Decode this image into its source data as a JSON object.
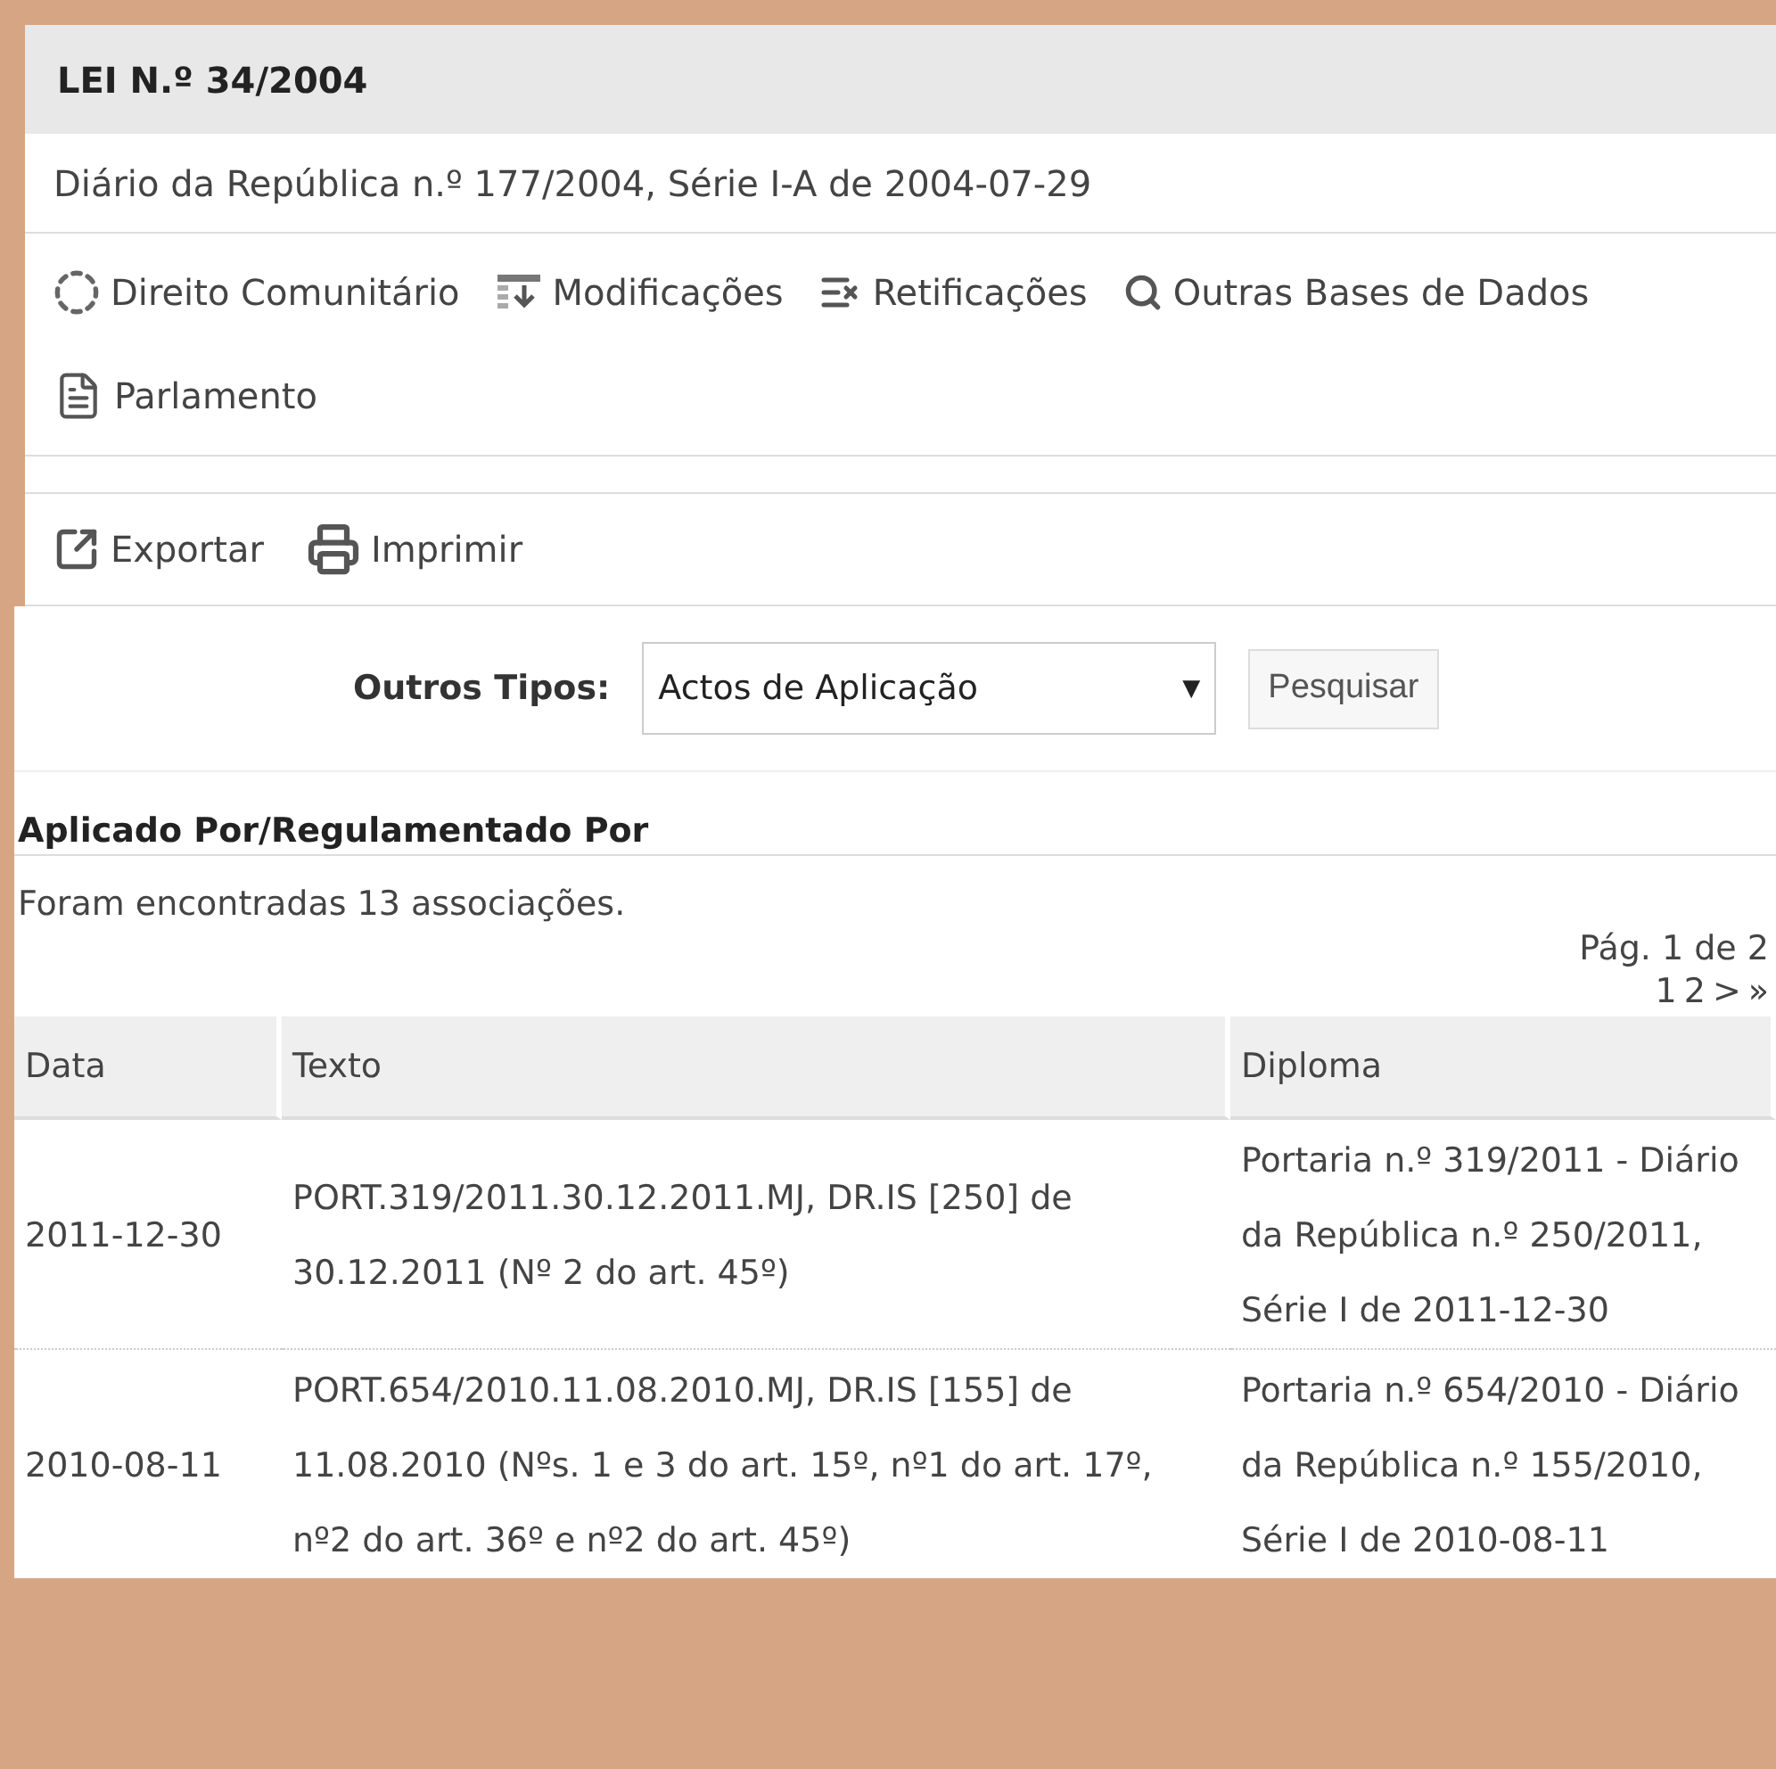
{
  "title": "LEI N.º 34/2004",
  "subtitle": "Diário da República n.º 177/2004, Série I-A de 2004-07-29",
  "links": [
    {
      "kind": "community",
      "label": "Direito Comunitário"
    },
    {
      "kind": "changes",
      "label": "Modificações"
    },
    {
      "kind": "corrections",
      "label": "Retificações"
    },
    {
      "kind": "search",
      "label": "Outras Bases de Dados"
    },
    {
      "kind": "parliament",
      "label": "Parlamento"
    }
  ],
  "actions": [
    {
      "kind": "export",
      "label": "Exportar"
    },
    {
      "kind": "print",
      "label": "Imprimir"
    }
  ],
  "filter": {
    "label": "Outros Tipos:",
    "value": "Actos de Aplicação",
    "caret": "▼",
    "button": "Pesquisar"
  },
  "section_title": "Aplicado Por/Regulamentado Por",
  "count_text": "Foram encontradas 13 associações.",
  "pagination": {
    "info": "Pág. 1 de 2",
    "pages": [
      "1",
      "2",
      ">",
      "»"
    ]
  },
  "table": {
    "columns": [
      "Data",
      "Texto",
      "Diploma"
    ],
    "rows": [
      [
        "2011-12-30",
        "PORT.319/2011.30.12.2011.MJ, DR.IS [250] de 30.12.2011 (Nº 2 do art. 45º)",
        "Portaria n.º 319/2011 - Diário da República n.º 250/2011, Série I de 2011-12-30"
      ],
      [
        "2010-08-11",
        "PORT.654/2010.11.08.2010.MJ, DR.IS [155] de 11.08.2010 (Nºs. 1 e 3 do art. 15º, nº1 do art. 17º, nº2 do art. 36º e nº2 do art. 45º)",
        "Portaria n.º 654/2010 - Diário da República n.º 155/2010, Série I de 2010-08-11"
      ]
    ]
  }
}
